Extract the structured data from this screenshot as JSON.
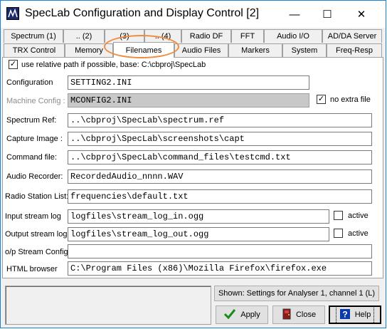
{
  "window": {
    "title": "SpecLab   Configuration and Display Control [2]",
    "minimize": "—",
    "maximize": "☐",
    "close": "✕"
  },
  "tabs_row1": [
    {
      "label": "Spectrum (1)"
    },
    {
      "label": ".. (2)"
    },
    {
      "label": "(3)"
    },
    {
      "label": ".. (4)"
    },
    {
      "label": "Radio DF"
    },
    {
      "label": "FFT"
    },
    {
      "label": "Audio I/O"
    },
    {
      "label": "AD/DA Server"
    }
  ],
  "tabs_row2": [
    {
      "label": "TRX Control"
    },
    {
      "label": "Memory"
    },
    {
      "label": "Filenames"
    },
    {
      "label": "Audio Files"
    },
    {
      "label": "Markers"
    },
    {
      "label": "System"
    },
    {
      "label": "Freq-Resp"
    }
  ],
  "active_tab": "Filenames",
  "relative_path": {
    "checked": "✓",
    "label": "use relative path if possible, base: C:\\cbproj\\SpecLab"
  },
  "fields": [
    {
      "label": "Configuration",
      "value": "SETTING2.INI"
    },
    {
      "label": "Machine Config :",
      "value": "MCONFIG2.INI",
      "disabled": true
    },
    {
      "label": "Spectrum Ref:",
      "value": "..\\cbproj\\SpecLab\\spectrum.ref"
    },
    {
      "label": "Capture Image :",
      "value": "..\\cbproj\\SpecLab\\screenshots\\capt"
    },
    {
      "label": "Command file:",
      "value": "..\\cbproj\\SpecLab\\command_files\\testcmd.txt"
    },
    {
      "label": "Audio Recorder:",
      "value": "RecordedAudio_nnnn.WAV"
    },
    {
      "label": "Radio Station List:",
      "value": "frequencies\\default.txt"
    },
    {
      "label": "Input stream log",
      "value": "logfiles\\stream_log_in.ogg"
    },
    {
      "label": "Output stream log",
      "value": "logfiles\\stream_log_out.ogg"
    },
    {
      "label": "o/p Stream Config",
      "value": ""
    },
    {
      "label": "HTML browser",
      "value": "C:\\Program Files (x86)\\Mozilla Firefox\\firefox.exe"
    }
  ],
  "no_extra_file": {
    "checked": "✓",
    "label": "no extra file"
  },
  "input_active": {
    "label": "active"
  },
  "output_active": {
    "label": "active"
  },
  "shown_button": "Shown: Settings for Analyser 1, channel 1 (L)",
  "apply_button": "Apply",
  "close_button": "Close",
  "help_button": "Help",
  "colors": {
    "accent": "#1883d7",
    "highlight_oval": "#f08a3c"
  }
}
